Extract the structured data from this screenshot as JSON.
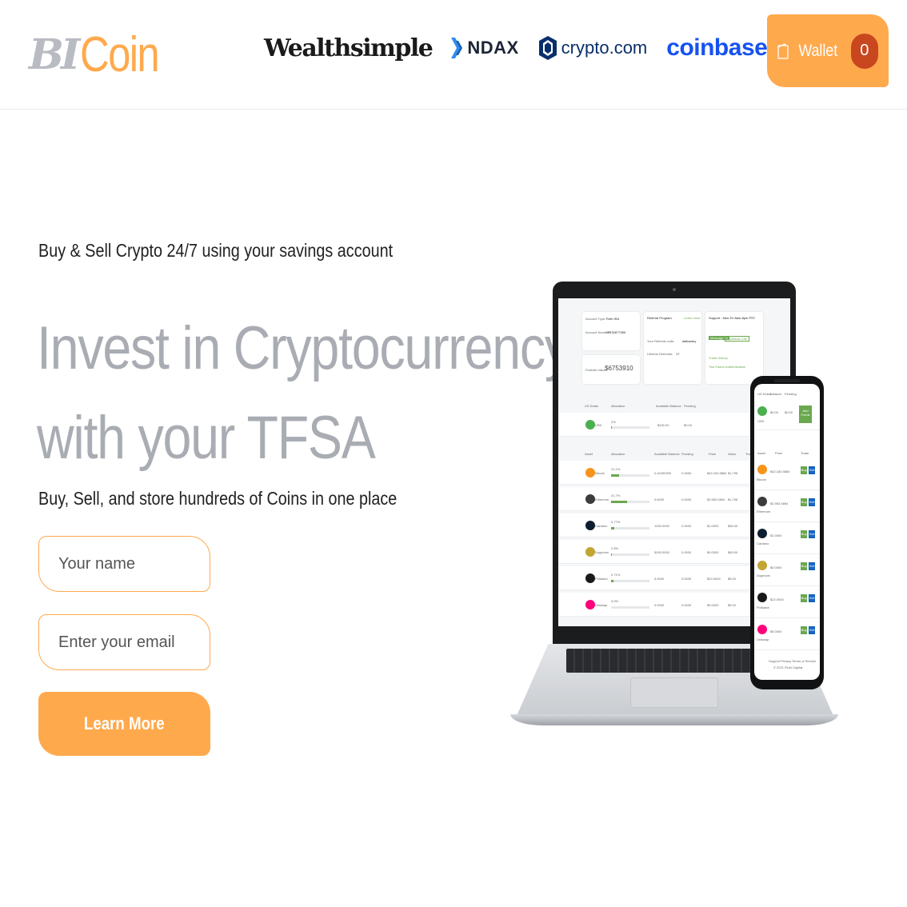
{
  "header": {
    "logo": {
      "bi": "BI",
      "coin": "Coin"
    },
    "partners": [
      {
        "name": "Wealthsimple",
        "icon": "wealthsimple-logo"
      },
      {
        "name": "NDAX",
        "icon": "ndax-chevron-icon"
      },
      {
        "name": "crypto.com",
        "icon": "crypto-com-lion-icon"
      },
      {
        "name": "coinbase",
        "icon": "coinbase-logo"
      }
    ],
    "wallet": {
      "label": "Wallet",
      "count": "0",
      "icon": "wallet-icon"
    }
  },
  "hero": {
    "tagline": "Buy & Sell Crypto 24/7 using your savings account",
    "headline_line1": "Invest in Cryptocurrency",
    "headline_line2": "with your TFSA",
    "subline": "Buy, Sell, and store hundreds of Coins in one place"
  },
  "form": {
    "name_placeholder": "Your name",
    "email_placeholder": "Enter your email",
    "submit_label": "Learn More"
  },
  "colors": {
    "accent": "#ffa94d",
    "headline": "#a9adb3",
    "badge": "#c9471f"
  },
  "mockup": {
    "account_card": {
      "account_type_label": "Account Type:",
      "account_type": "Roth IRA",
      "account_number_label": "Account Number:",
      "account_number": "ITR32877059",
      "portfolio_label": "Portfolio Value",
      "portfolio_value": "$6753910"
    },
    "referral_card": {
      "title": "Referral Program",
      "link": "Learn more",
      "code_label": "Your Referral code:",
      "code": "ladkwwey",
      "lifetime_label": "Lifetime Referrals:",
      "lifetime": "17"
    },
    "support_card": {
      "title": "Support - Mon-Fri 8am-8pm PST",
      "msg": "Message Us",
      "schedule": "Schedule Call",
      "link1": "Trade History",
      "link2": "Two-Factor Authentication"
    },
    "usd_header": [
      "US Dollar",
      "Allocation",
      "Available Balance",
      "Pending"
    ],
    "usd_row": {
      "asset": "USD",
      "alloc": "2%",
      "balance": "$200.00",
      "pending": "$0.00"
    },
    "asset_header": [
      "Asset",
      "Allocation",
      "Available Balance",
      "Pending",
      "Price",
      "Value",
      "Trade"
    ],
    "assets": [
      {
        "name": "Bitcoin",
        "alloc": "21.1%",
        "fill": 0.21,
        "bal": "0.44490000",
        "pend": "0.0000",
        "price": "$42,183.9884",
        "value": "$1,798",
        "color": "#f7931a"
      },
      {
        "name": "Ethereum",
        "alloc": "41.7%",
        "fill": 0.42,
        "bal": "0.6000",
        "pend": "0.0000",
        "price": "$2,963.0894",
        "value": "$1,798",
        "color": "#3c3c3d"
      },
      {
        "name": "Cardano",
        "alloc": "0.77%",
        "fill": 0.08,
        "bal": "1000.0000",
        "pend": "0.0000",
        "price": "$1.0000",
        "value": "$56.00",
        "color": "#0d1e30"
      },
      {
        "name": "Dogecoin",
        "alloc": "2.5%",
        "fill": 0.03,
        "bal": "5000.0000",
        "pend": "0.0000",
        "price": "$0.0000",
        "value": "$65.00",
        "color": "#c2a633"
      },
      {
        "name": "Polkadot",
        "alloc": "0.71%",
        "fill": 0.06,
        "bal": "5.0000",
        "pend": "0.0000",
        "price": "$22.0000",
        "value": "$5.00",
        "color": "#1a1a1a"
      },
      {
        "name": "Uniswap",
        "alloc": "0.0%",
        "fill": 0.0,
        "bal": "0.0000",
        "pend": "0.0000",
        "price": "$5.0000",
        "value": "$5.00",
        "color": "#ff007a"
      }
    ],
    "phone": {
      "header": [
        "US Dollar",
        "Balance",
        "Pending"
      ],
      "usd": {
        "asset": "USD",
        "balance": "$0.00",
        "pending": "$0.00",
        "action": "Add Funds"
      },
      "asset_header": [
        "Asset",
        "Price",
        "Trade"
      ],
      "buy": "Buy",
      "sell": "Sell",
      "footer1": "Support  Privacy  Terms of Service",
      "footer2": "© 2021 Fluid Capital"
    }
  }
}
